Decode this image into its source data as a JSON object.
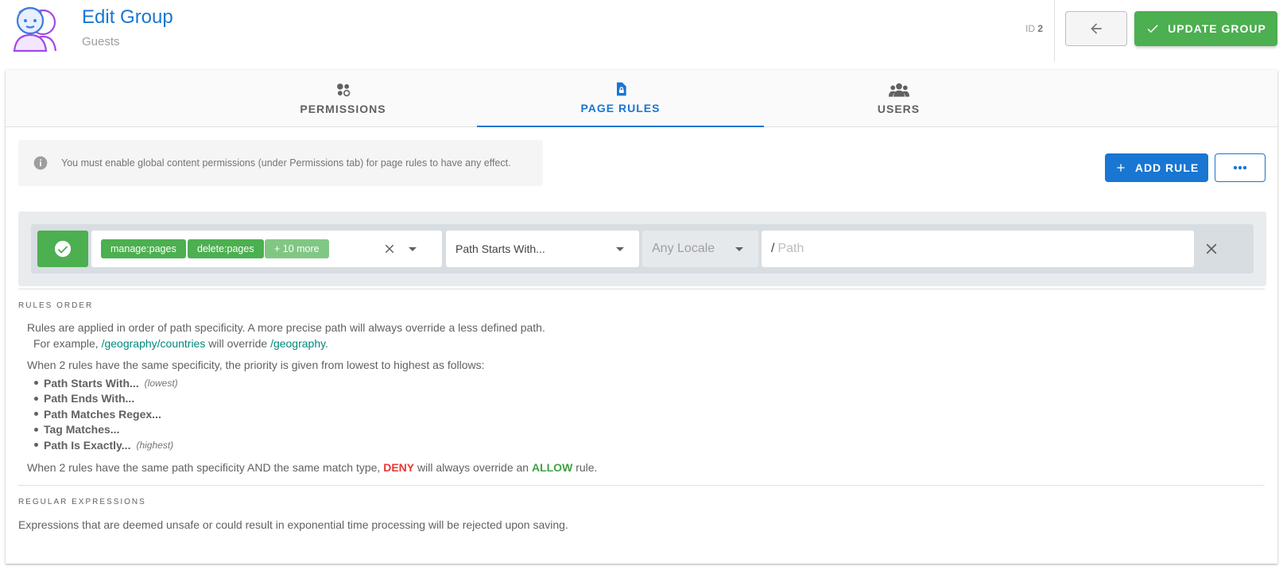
{
  "header": {
    "title": "Edit Group",
    "subtitle": "Guests",
    "id_label": "ID",
    "id_value": "2",
    "update_label": "UPDATE GROUP"
  },
  "tabs": [
    {
      "label": "PERMISSIONS",
      "icon": "permissions-icon"
    },
    {
      "label": "PAGE RULES",
      "icon": "page-lock-icon",
      "active": true
    },
    {
      "label": "USERS",
      "icon": "users-icon"
    }
  ],
  "info": {
    "text": "You must enable global content permissions (under Permissions tab) for page rules to have any effect."
  },
  "actions": {
    "add_rule_label": "ADD RULE"
  },
  "rule": {
    "mode": "allow",
    "permissions": [
      "manage:pages",
      "delete:pages"
    ],
    "more_label": "+ 10 more",
    "match": "Path Starts With...",
    "locale_placeholder": "Any Locale",
    "path_prefix": "/",
    "path_placeholder": "Path"
  },
  "rules_order": {
    "label": "RULES ORDER",
    "line1": "Rules are applied in order of path specificity. A more precise path will always override a less defined path.",
    "example_prefix": "For example,",
    "example_path1": "/geography/countries",
    "example_mid": "will override",
    "example_path2": "/geography",
    "example_end": ".",
    "priority_intro": "When 2 rules have the same specificity, the priority is given from lowest to highest as follows:",
    "priorities": [
      {
        "name": "Path Starts With...",
        "note": "(lowest)"
      },
      {
        "name": "Path Ends With...",
        "note": ""
      },
      {
        "name": "Path Matches Regex...",
        "note": ""
      },
      {
        "name": "Tag Matches...",
        "note": ""
      },
      {
        "name": "Path Is Exactly...",
        "note": "(highest)"
      }
    ],
    "conflict_prefix": "When 2 rules have the same path specificity AND the same match type,",
    "deny": "DENY",
    "conflict_mid": "will always override an",
    "allow": "ALLOW",
    "conflict_end": "rule."
  },
  "regex": {
    "label": "REGULAR EXPRESSIONS",
    "text": "Expressions that are deemed unsafe or could result in exponential time processing will be rejected upon saving."
  },
  "colors": {
    "primary": "#1976d2",
    "success": "#4caf50",
    "deny": "#e53935",
    "link": "#00897b",
    "logo": "#a349e8"
  }
}
